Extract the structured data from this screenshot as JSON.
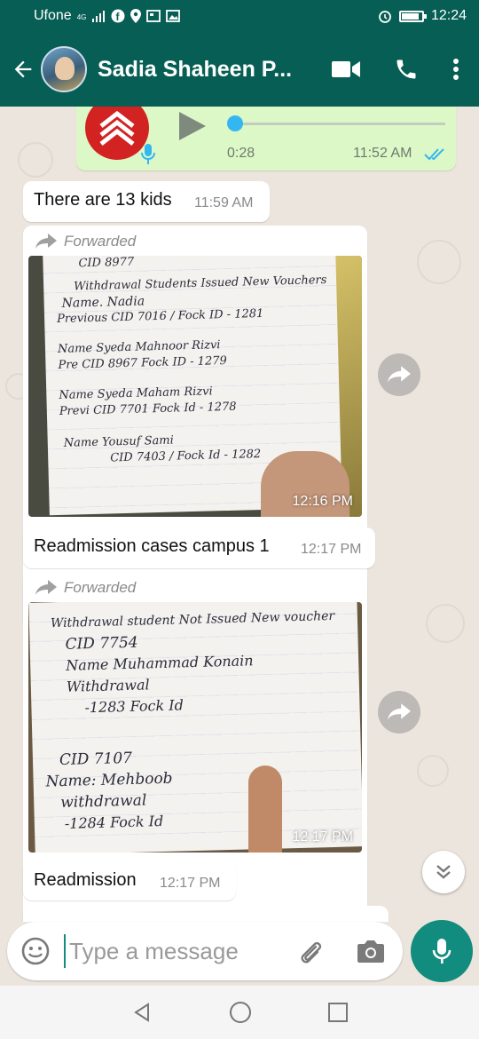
{
  "statusbar": {
    "carrier": "Ufone",
    "network": "4G",
    "time": "12:24"
  },
  "header": {
    "title": "Sadia Shaheen P...",
    "back_icon": "arrow-left-icon",
    "video_icon": "video-call-icon",
    "call_icon": "phone-icon",
    "menu_icon": "more-vert-icon"
  },
  "voice_message": {
    "duration": "0:28",
    "time": "11:52 AM",
    "progress": 0.0
  },
  "messages": [
    {
      "text": "There are 13 kids",
      "time": "11:59 AM"
    },
    {
      "forwarded_label": "Forwarded",
      "time": "12:16 PM",
      "handwriting": [
        "CID 8977",
        "Withdrawal Students Issued New Vouchers",
        "Name. Nadia",
        "Previous CID 7016 / Fock ID - 1281",
        "Name Syeda Mahnoor Rizvi",
        "Pre CID 8967  Fock ID - 1279",
        "Name Syeda Maham Rizvi",
        "Previ CID 7701  Fock Id - 1278",
        "Name  Yousuf Sami",
        "CID 7403 / Fock Id - 1282"
      ]
    },
    {
      "text": "Readmission cases campus 1",
      "time": "12:17 PM"
    },
    {
      "forwarded_label": "Forwarded",
      "time": "12:17 PM",
      "handwriting": [
        "Withdrawal student Not Issued New voucher",
        "CID 7754",
        "Name Muhammad Konain",
        "Withdrawal",
        "-1283 Fock Id",
        "CID 7107",
        "Name: Mehboob",
        "withdrawal",
        "-1284 Fock Id"
      ]
    },
    {
      "text": "Readmission",
      "time": "12:17 PM"
    }
  ],
  "input": {
    "placeholder": "Type a message"
  }
}
